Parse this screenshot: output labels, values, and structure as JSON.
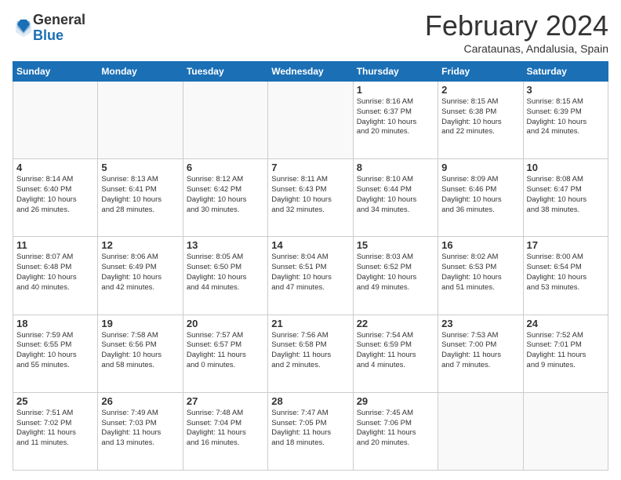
{
  "logo": {
    "general": "General",
    "blue": "Blue"
  },
  "header": {
    "month": "February 2024",
    "location": "Carataunas, Andalusia, Spain"
  },
  "days": [
    "Sunday",
    "Monday",
    "Tuesday",
    "Wednesday",
    "Thursday",
    "Friday",
    "Saturday"
  ],
  "weeks": [
    [
      {
        "day": "",
        "info": ""
      },
      {
        "day": "",
        "info": ""
      },
      {
        "day": "",
        "info": ""
      },
      {
        "day": "",
        "info": ""
      },
      {
        "day": "1",
        "info": "Sunrise: 8:16 AM\nSunset: 6:37 PM\nDaylight: 10 hours\nand 20 minutes."
      },
      {
        "day": "2",
        "info": "Sunrise: 8:15 AM\nSunset: 6:38 PM\nDaylight: 10 hours\nand 22 minutes."
      },
      {
        "day": "3",
        "info": "Sunrise: 8:15 AM\nSunset: 6:39 PM\nDaylight: 10 hours\nand 24 minutes."
      }
    ],
    [
      {
        "day": "4",
        "info": "Sunrise: 8:14 AM\nSunset: 6:40 PM\nDaylight: 10 hours\nand 26 minutes."
      },
      {
        "day": "5",
        "info": "Sunrise: 8:13 AM\nSunset: 6:41 PM\nDaylight: 10 hours\nand 28 minutes."
      },
      {
        "day": "6",
        "info": "Sunrise: 8:12 AM\nSunset: 6:42 PM\nDaylight: 10 hours\nand 30 minutes."
      },
      {
        "day": "7",
        "info": "Sunrise: 8:11 AM\nSunset: 6:43 PM\nDaylight: 10 hours\nand 32 minutes."
      },
      {
        "day": "8",
        "info": "Sunrise: 8:10 AM\nSunset: 6:44 PM\nDaylight: 10 hours\nand 34 minutes."
      },
      {
        "day": "9",
        "info": "Sunrise: 8:09 AM\nSunset: 6:46 PM\nDaylight: 10 hours\nand 36 minutes."
      },
      {
        "day": "10",
        "info": "Sunrise: 8:08 AM\nSunset: 6:47 PM\nDaylight: 10 hours\nand 38 minutes."
      }
    ],
    [
      {
        "day": "11",
        "info": "Sunrise: 8:07 AM\nSunset: 6:48 PM\nDaylight: 10 hours\nand 40 minutes."
      },
      {
        "day": "12",
        "info": "Sunrise: 8:06 AM\nSunset: 6:49 PM\nDaylight: 10 hours\nand 42 minutes."
      },
      {
        "day": "13",
        "info": "Sunrise: 8:05 AM\nSunset: 6:50 PM\nDaylight: 10 hours\nand 44 minutes."
      },
      {
        "day": "14",
        "info": "Sunrise: 8:04 AM\nSunset: 6:51 PM\nDaylight: 10 hours\nand 47 minutes."
      },
      {
        "day": "15",
        "info": "Sunrise: 8:03 AM\nSunset: 6:52 PM\nDaylight: 10 hours\nand 49 minutes."
      },
      {
        "day": "16",
        "info": "Sunrise: 8:02 AM\nSunset: 6:53 PM\nDaylight: 10 hours\nand 51 minutes."
      },
      {
        "day": "17",
        "info": "Sunrise: 8:00 AM\nSunset: 6:54 PM\nDaylight: 10 hours\nand 53 minutes."
      }
    ],
    [
      {
        "day": "18",
        "info": "Sunrise: 7:59 AM\nSunset: 6:55 PM\nDaylight: 10 hours\nand 55 minutes."
      },
      {
        "day": "19",
        "info": "Sunrise: 7:58 AM\nSunset: 6:56 PM\nDaylight: 10 hours\nand 58 minutes."
      },
      {
        "day": "20",
        "info": "Sunrise: 7:57 AM\nSunset: 6:57 PM\nDaylight: 11 hours\nand 0 minutes."
      },
      {
        "day": "21",
        "info": "Sunrise: 7:56 AM\nSunset: 6:58 PM\nDaylight: 11 hours\nand 2 minutes."
      },
      {
        "day": "22",
        "info": "Sunrise: 7:54 AM\nSunset: 6:59 PM\nDaylight: 11 hours\nand 4 minutes."
      },
      {
        "day": "23",
        "info": "Sunrise: 7:53 AM\nSunset: 7:00 PM\nDaylight: 11 hours\nand 7 minutes."
      },
      {
        "day": "24",
        "info": "Sunrise: 7:52 AM\nSunset: 7:01 PM\nDaylight: 11 hours\nand 9 minutes."
      }
    ],
    [
      {
        "day": "25",
        "info": "Sunrise: 7:51 AM\nSunset: 7:02 PM\nDaylight: 11 hours\nand 11 minutes."
      },
      {
        "day": "26",
        "info": "Sunrise: 7:49 AM\nSunset: 7:03 PM\nDaylight: 11 hours\nand 13 minutes."
      },
      {
        "day": "27",
        "info": "Sunrise: 7:48 AM\nSunset: 7:04 PM\nDaylight: 11 hours\nand 16 minutes."
      },
      {
        "day": "28",
        "info": "Sunrise: 7:47 AM\nSunset: 7:05 PM\nDaylight: 11 hours\nand 18 minutes."
      },
      {
        "day": "29",
        "info": "Sunrise: 7:45 AM\nSunset: 7:06 PM\nDaylight: 11 hours\nand 20 minutes."
      },
      {
        "day": "",
        "info": ""
      },
      {
        "day": "",
        "info": ""
      }
    ]
  ]
}
